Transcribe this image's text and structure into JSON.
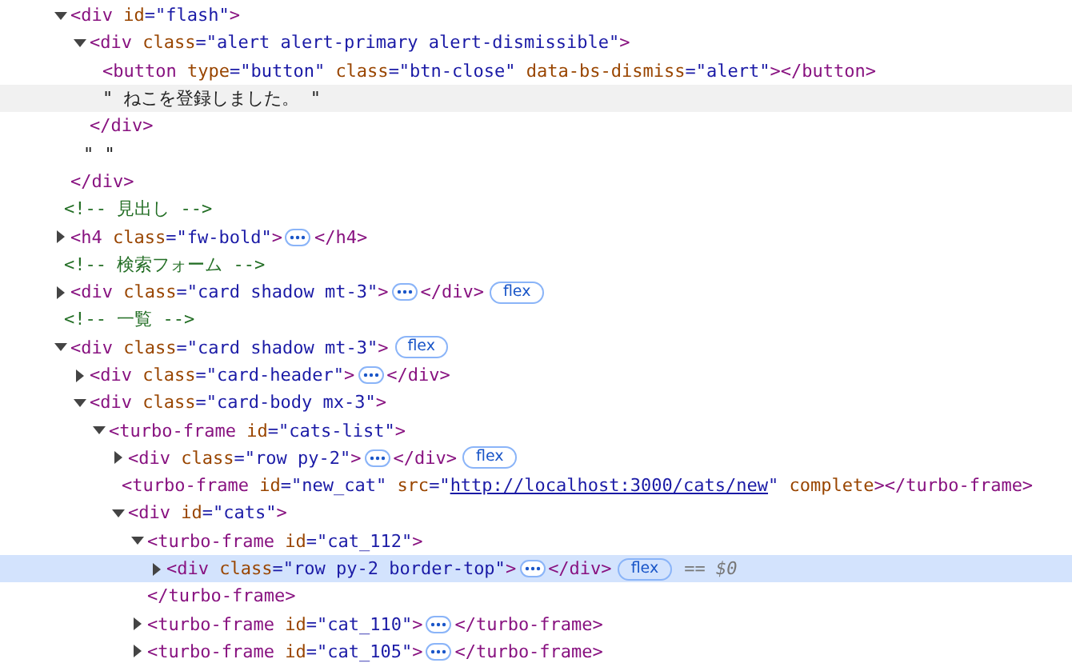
{
  "dom_tree": [
    {
      "kind": "element",
      "tag": "<div",
      "attrs": [
        {
          "name": "id",
          "value": "=\"flash\""
        }
      ],
      "tag_end": ">",
      "expanded": true,
      "selected": false,
      "hovered": false,
      "close_tag": "</div>",
      "children": [
        {
          "kind": "element",
          "tag": "<div",
          "attrs": [
            {
              "name": "class",
              "value": "=\"alert alert-primary alert-dismissible\""
            }
          ],
          "tag_end": ">",
          "expanded": true,
          "selected": false,
          "hovered": false,
          "close_tag": "</div>",
          "children": [
            {
              "kind": "leaf",
              "tag": "<button",
              "attrs": [
                {
                  "name": "type",
                  "value": "=\"button\""
                },
                {
                  "name": "class",
                  "value": "=\"btn-close\""
                },
                {
                  "name": "data-bs-dismiss",
                  "value": "=\"alert\""
                }
              ],
              "tag_end": ">",
              "selected": false,
              "hovered": false,
              "inline_close": "</button>"
            },
            {
              "kind": "text",
              "text": "\" ねこを登録しました。 \"",
              "selected": false,
              "hovered": true
            }
          ]
        },
        {
          "kind": "text",
          "text": "\" \"",
          "selected": false,
          "hovered": false
        }
      ]
    },
    {
      "kind": "comment",
      "text": "<!-- 見出し -->",
      "selected": false,
      "hovered": false
    },
    {
      "kind": "element",
      "tag": "<h4",
      "attrs": [
        {
          "name": "class",
          "value": "=\"fw-bold\""
        }
      ],
      "tag_end": ">",
      "expanded": false,
      "selected": false,
      "hovered": false,
      "inline_close": "</h4>"
    },
    {
      "kind": "comment",
      "text": "<!-- 検索フォーム -->",
      "selected": false,
      "hovered": false
    },
    {
      "kind": "element",
      "tag": "<div",
      "attrs": [
        {
          "name": "class",
          "value": "=\"card shadow mt-3\""
        }
      ],
      "tag_end": ">",
      "expanded": false,
      "selected": false,
      "hovered": false,
      "inline_close": "</div>",
      "badge": "flex"
    },
    {
      "kind": "comment",
      "text": "<!-- 一覧 -->",
      "selected": false,
      "hovered": false
    },
    {
      "kind": "element",
      "tag": "<div",
      "attrs": [
        {
          "name": "class",
          "value": "=\"card shadow mt-3\""
        }
      ],
      "tag_end": ">",
      "expanded": true,
      "selected": false,
      "hovered": false,
      "badge": "flex",
      "children": [
        {
          "kind": "element",
          "tag": "<div",
          "attrs": [
            {
              "name": "class",
              "value": "=\"card-header\""
            }
          ],
          "tag_end": ">",
          "expanded": false,
          "selected": false,
          "hovered": false,
          "inline_close": "</div>"
        },
        {
          "kind": "element",
          "tag": "<div",
          "attrs": [
            {
              "name": "class",
              "value": "=\"card-body mx-3\""
            }
          ],
          "tag_end": ">",
          "expanded": true,
          "selected": false,
          "hovered": false,
          "children": [
            {
              "kind": "element",
              "tag": "<turbo-frame",
              "attrs": [
                {
                  "name": "id",
                  "value": "=\"cats-list\""
                }
              ],
              "tag_end": ">",
              "expanded": true,
              "selected": false,
              "hovered": false,
              "children": [
                {
                  "kind": "element",
                  "tag": "<div",
                  "attrs": [
                    {
                      "name": "class",
                      "value": "=\"row py-2\""
                    }
                  ],
                  "tag_end": ">",
                  "expanded": false,
                  "selected": false,
                  "hovered": false,
                  "inline_close": "</div>",
                  "badge": "flex"
                },
                {
                  "kind": "leaf",
                  "tag": "<turbo-frame",
                  "attrs": [
                    {
                      "name": "id",
                      "value": "=\"new_cat\""
                    },
                    {
                      "name": "src",
                      "value": "=\"",
                      "link": "http://localhost:3000/cats/new",
                      "value_end": "\""
                    },
                    {
                      "name": "complete"
                    }
                  ],
                  "tag_end": ">",
                  "selected": false,
                  "hovered": false,
                  "inline_close": "</turbo-frame>"
                },
                {
                  "kind": "element",
                  "tag": "<div",
                  "attrs": [
                    {
                      "name": "id",
                      "value": "=\"cats\""
                    }
                  ],
                  "tag_end": ">",
                  "expanded": true,
                  "selected": false,
                  "hovered": false,
                  "children": [
                    {
                      "kind": "element",
                      "tag": "<turbo-frame",
                      "attrs": [
                        {
                          "name": "id",
                          "value": "=\"cat_112\""
                        }
                      ],
                      "tag_end": ">",
                      "expanded": true,
                      "selected": false,
                      "hovered": false,
                      "close_tag": "</turbo-frame>",
                      "children": [
                        {
                          "kind": "element",
                          "tag": "<div",
                          "attrs": [
                            {
                              "name": "class",
                              "value": "=\"row py-2 border-top\""
                            }
                          ],
                          "tag_end": ">",
                          "expanded": false,
                          "selected": true,
                          "hovered": false,
                          "inline_close": "</div>",
                          "badge": "flex",
                          "console_ref": "== $0"
                        }
                      ]
                    },
                    {
                      "kind": "element",
                      "tag": "<turbo-frame",
                      "attrs": [
                        {
                          "name": "id",
                          "value": "=\"cat_110\""
                        }
                      ],
                      "tag_end": ">",
                      "expanded": false,
                      "selected": false,
                      "hovered": false,
                      "inline_close": "</turbo-frame>"
                    },
                    {
                      "kind": "element",
                      "tag": "<turbo-frame",
                      "attrs": [
                        {
                          "name": "id",
                          "value": "=\"cat_105\""
                        }
                      ],
                      "tag_end": ">",
                      "expanded": false,
                      "selected": false,
                      "hovered": false,
                      "inline_close": "</turbo-frame>"
                    }
                  ]
                }
              ]
            }
          ]
        }
      ]
    }
  ]
}
